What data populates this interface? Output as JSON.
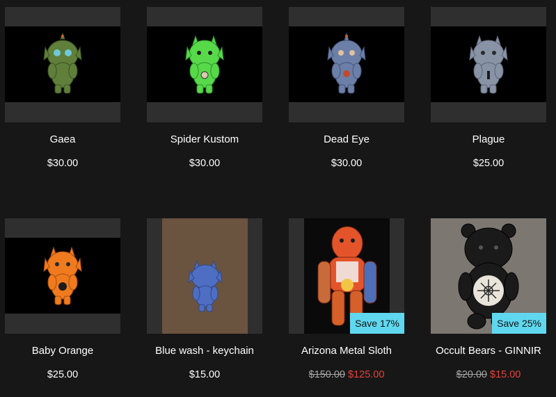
{
  "products": [
    {
      "name": "Gaea",
      "price": "$30.00",
      "figure_color": "#5f7f3a"
    },
    {
      "name": "Spider Kustom",
      "price": "$30.00",
      "figure_color": "#57d94a"
    },
    {
      "name": "Dead Eye",
      "price": "$30.00",
      "figure_color": "#6c7fa8"
    },
    {
      "name": "Plague",
      "price": "$25.00",
      "figure_color": "#8993a6"
    },
    {
      "name": "Baby Orange",
      "price": "$25.00",
      "figure_color": "#f07b1f"
    },
    {
      "name": "Blue wash - keychain",
      "price": "$15.00",
      "figure_color": "#4d6ec2"
    },
    {
      "name": "Arizona Metal Sloth",
      "old_price": "$150.00",
      "sale_price": "$125.00",
      "badge": "Save 17%",
      "figure_color": "#e4542a"
    },
    {
      "name": "Occult Bears - GINNIR",
      "old_price": "$20.00",
      "sale_price": "$15.00",
      "badge": "Save 25%",
      "figure_color": "#1a1a1a"
    }
  ],
  "colors": {
    "background": "#171717",
    "thumb_frame": "#2f2f2f",
    "badge": "#5fd8ef",
    "sale_price": "#e8413b",
    "old_price": "#a5a5a5"
  }
}
